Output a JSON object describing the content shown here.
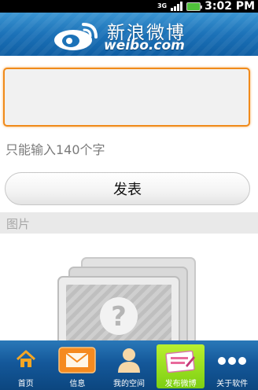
{
  "status_bar": {
    "network": "3G",
    "time": "3:02 PM"
  },
  "header": {
    "logo_cn": "新浪微博",
    "logo_en": "weibo.com"
  },
  "compose": {
    "value": "",
    "limit_text": "只能输入140个字"
  },
  "post_button": {
    "label": "发表"
  },
  "image_section": {
    "title": "图片"
  },
  "bottom_nav": {
    "items": [
      {
        "label": "首页",
        "icon": "home-icon"
      },
      {
        "label": "信息",
        "icon": "mail-icon"
      },
      {
        "label": "我的空间",
        "icon": "person-icon"
      },
      {
        "label": "发布微博",
        "icon": "compose-icon",
        "active": true
      },
      {
        "label": "关于软件",
        "icon": "more-icon"
      }
    ]
  },
  "colors": {
    "header_blue": "#1c72b8",
    "accent_orange": "#f08a1a",
    "active_green": "#8ad81a",
    "nav_blue": "#14589a"
  }
}
